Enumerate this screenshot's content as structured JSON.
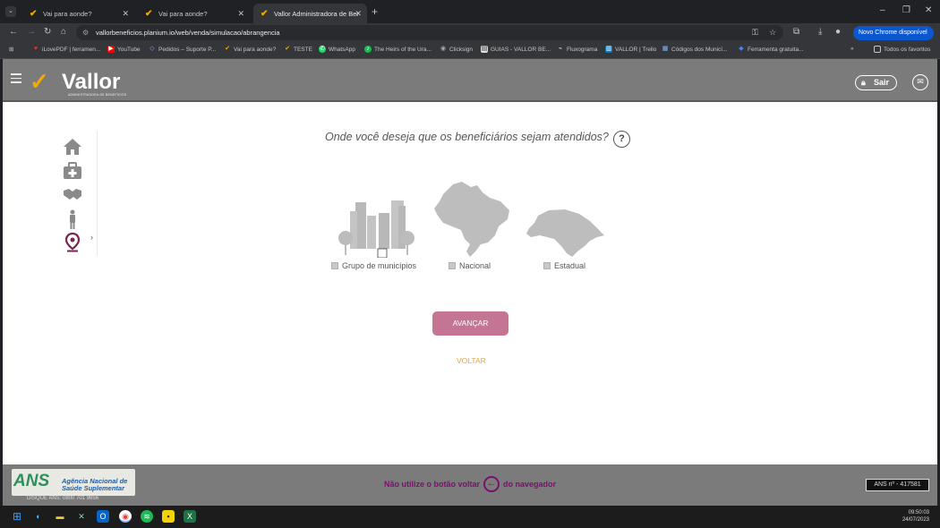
{
  "browser": {
    "tabs": [
      {
        "title": "Vai para aonde?"
      },
      {
        "title": "Vai para aonde?"
      },
      {
        "title": "Vallor Administradora de Benef"
      }
    ],
    "url": "vallorbeneficios.planium.io/web/venda/simulacao/abrangencia",
    "update_label": "Novo Chrome disponível",
    "bookmarks": [
      "iLovePDF | ferramen...",
      "YouTube",
      "Pedidos – Suporte P...",
      "Vai para aonde?",
      "TESTE",
      "WhatsApp",
      "The Heirs of the Ura...",
      "Clicksign",
      "GUIAS - VALLOR BE...",
      "Fluxograma",
      "VALLOR | Trello",
      "Códigos dos Municí...",
      "Ferramenta gratuita..."
    ],
    "all_bookmarks": "Todos os favoritos"
  },
  "header": {
    "brand": "Vallor",
    "brand_sub": "ADMINISTRADORA DE BENEFÍCIOS",
    "logout_label": "Sair"
  },
  "sidebar": {
    "items": [
      {
        "icon": "home-icon"
      },
      {
        "icon": "medical-kit-icon"
      },
      {
        "icon": "handshake-icon"
      },
      {
        "icon": "person-icon"
      },
      {
        "icon": "location-pin-icon",
        "active": true
      }
    ]
  },
  "main": {
    "question": "Onde você deseja que os beneficiários sejam atendidos?",
    "help_label": "?",
    "options": [
      {
        "label": "Grupo de municípios",
        "checked": false
      },
      {
        "label": "Nacional",
        "checked": false
      },
      {
        "label": "Estadual",
        "checked": false
      }
    ],
    "next_button": "AVANÇAR",
    "back_link": "VOLTAR"
  },
  "footer": {
    "ans_logo_text": "ANS",
    "ans_name_line1": "Agência Nacional de",
    "ans_name_line2": "Saúde Suplementar",
    "disque": "DISQUE ANS: 0800 701 9656",
    "warning_before": "Não utilize o botão voltar",
    "warning_after": "do navegador",
    "ans_registration": "ANS nº - 417581"
  },
  "taskbar": {
    "time": "09:50:03",
    "date": "24/07/2023"
  },
  "colors": {
    "accent_primary": "#7b2453",
    "button": "#c47593",
    "link": "#e3a545",
    "header_bg": "#7b7b7b"
  }
}
